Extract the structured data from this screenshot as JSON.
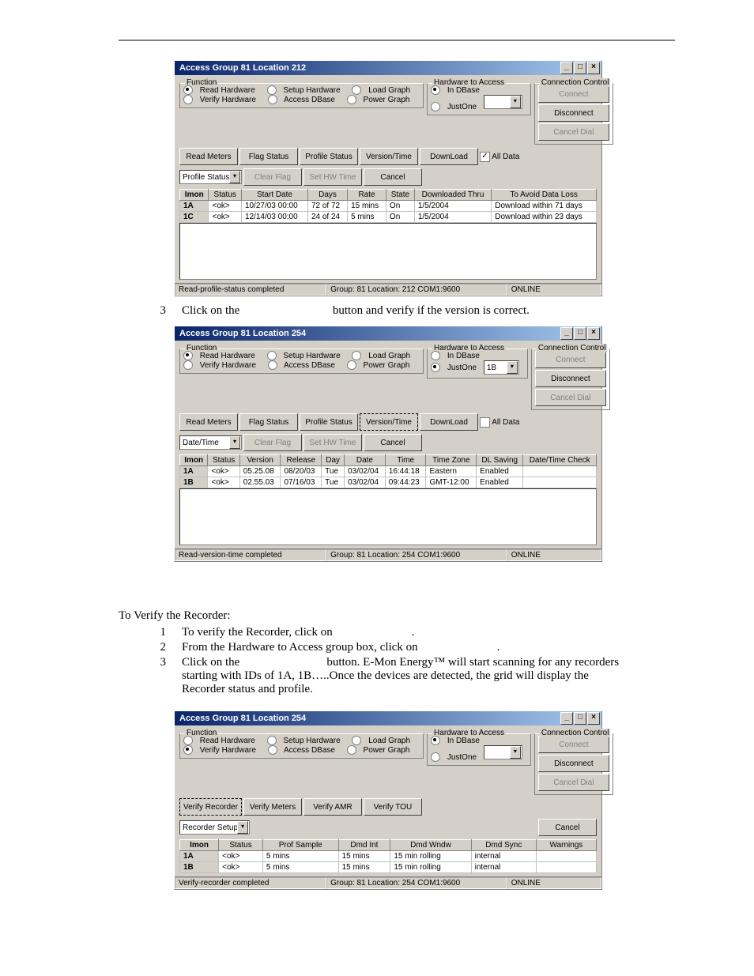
{
  "step3": {
    "num": "3",
    "textA": "Click on the",
    "textB": "button and verify if the version is correct."
  },
  "win1": {
    "title": "Access Group 81 Location 212",
    "function": {
      "legend": "Function",
      "opts": [
        "Read Hardware",
        "Setup Hardware",
        "Load Graph",
        "Verify Hardware",
        "Access DBase",
        "Power Graph"
      ],
      "sel": 0
    },
    "hw": {
      "legend": "Hardware to Access",
      "opt1": "In DBase",
      "opt2": "JustOne",
      "sel": 0
    },
    "cc": {
      "legend": "Connection Control",
      "connect": "Connect",
      "disconnect": "Disconnect",
      "canceldial": "Cancel Dial"
    },
    "row": {
      "b1": "Read Meters",
      "b2": "Flag Status",
      "b3": "Profile Status",
      "b4": "Version/Time",
      "b5": "DownLoad",
      "chk": "All Data",
      "chkState": "✓",
      "drop": "Profile Status",
      "b6": "Clear Flag",
      "b7": "Set HW Time",
      "b8": "Cancel"
    },
    "grid": {
      "cols": [
        "Imon",
        "Status",
        "Start Date",
        "Days",
        "Rate",
        "State",
        "Downloaded Thru",
        "To Avoid Data Loss"
      ],
      "rows": [
        [
          "1A",
          "<ok>",
          "10/27/03 00:00",
          "72 of 72",
          "15 mins",
          "On",
          "1/5/2004",
          "Download within 71 days"
        ],
        [
          "1C",
          "<ok>",
          "12/14/03 00:00",
          "24 of 24",
          "5 mins",
          "On",
          "1/5/2004",
          "Download within 23 days"
        ]
      ]
    },
    "status": {
      "a": "Read-profile-status completed",
      "b": "Group: 81 Location: 212 COM1:9600",
      "c": "ONLINE"
    }
  },
  "win2": {
    "title": "Access Group 81 Location 254",
    "function": {
      "legend": "Function",
      "opts": [
        "Read Hardware",
        "Setup Hardware",
        "Load Graph",
        "Verify Hardware",
        "Access DBase",
        "Power Graph"
      ],
      "sel": 0
    },
    "hw": {
      "legend": "Hardware to Access",
      "opt1": "In DBase",
      "opt2": "JustOne",
      "sel": 1,
      "val": "1B"
    },
    "cc": {
      "legend": "Connection Control",
      "connect": "Connect",
      "disconnect": "Disconnect",
      "canceldial": "Cancel Dial"
    },
    "row": {
      "b1": "Read Meters",
      "b2": "Flag Status",
      "b3": "Profile Status",
      "b4": "Version/Time",
      "b5": "DownLoad",
      "chk": "All Data",
      "drop": "Date/Time",
      "b6": "Clear Flag",
      "b7": "Set HW Time",
      "b8": "Cancel"
    },
    "grid": {
      "cols": [
        "Imon",
        "Status",
        "Version",
        "Release",
        "Day",
        "Date",
        "Time",
        "Time Zone",
        "DL Saving",
        "Date/Time Check"
      ],
      "rows": [
        [
          "1A",
          "<ok>",
          "05.25.08",
          "08/20/03",
          "Tue",
          "03/02/04",
          "16:44:18",
          "Eastern",
          "Enabled",
          ""
        ],
        [
          "1B",
          "<ok>",
          "02.55.03",
          "07/16/03",
          "Tue",
          "03/02/04",
          "09:44:23",
          "GMT-12:00",
          "Enabled",
          ""
        ]
      ]
    },
    "status": {
      "a": "Read-version-time completed",
      "b": "Group: 81 Location: 254 COM1:9600",
      "c": "ONLINE"
    }
  },
  "verify": {
    "heading": "To Verify the Recorder:",
    "s1n": "1",
    "s1": "To verify the Recorder, click on",
    "s1b": ".",
    "s2n": "2",
    "s2": "From the Hardware to Access group box, click on",
    "s2b": ".",
    "s3n": "3",
    "s3a": "Click on the",
    "s3b": "button. E-Mon Energy™ will start scanning for any recorders starting with IDs of 1A, 1B…..Once the devices are detected, the grid will display the Recorder status and profile."
  },
  "win3": {
    "title": "Access Group 81 Location 254",
    "function": {
      "legend": "Function",
      "opts": [
        "Read Hardware",
        "Setup Hardware",
        "Load Graph",
        "Verify Hardware",
        "Access DBase",
        "Power Graph"
      ],
      "sel": 3
    },
    "hw": {
      "legend": "Hardware to Access",
      "opt1": "In DBase",
      "opt2": "JustOne",
      "sel": 0
    },
    "cc": {
      "legend": "Connection Control",
      "connect": "Connect",
      "disconnect": "Disconnect",
      "canceldial": "Cancel Dial"
    },
    "row": {
      "b1": "Verify Recorder",
      "b2": "Verify Meters",
      "b3": "Verify AMR",
      "b4": "Verify TOU",
      "drop": "Recorder Setup",
      "b8": "Cancel"
    },
    "grid": {
      "cols": [
        "Imon",
        "Status",
        "Prof Sample",
        "Dmd Int",
        "Dmd Wndw",
        "Dmd Sync",
        "Warnings"
      ],
      "rows": [
        [
          "1A",
          "<ok>",
          "5 mins",
          "15 mins",
          "15 min rolling",
          "internal",
          ""
        ],
        [
          "1B",
          "<ok>",
          "5 mins",
          "15 mins",
          "15 min rolling",
          "internal",
          ""
        ]
      ]
    },
    "status": {
      "a": "Verify-recorder completed",
      "b": "Group: 81 Location: 254 COM1:9600",
      "c": "ONLINE"
    }
  }
}
